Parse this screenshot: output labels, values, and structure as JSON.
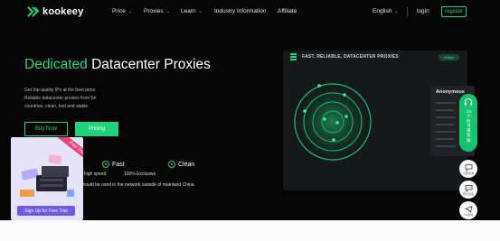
{
  "brand": {
    "name": "kookeey"
  },
  "nav": {
    "items": [
      {
        "label": "Price",
        "dropdown": true
      },
      {
        "label": "Proxies",
        "dropdown": true
      },
      {
        "label": "Learn",
        "dropdown": true
      },
      {
        "label": "Industry Information",
        "dropdown": false
      },
      {
        "label": "Affiliate",
        "dropdown": false
      }
    ],
    "language": "English",
    "login": "login",
    "register": "register"
  },
  "hero": {
    "title_accent": "Dedicated",
    "title_rest": "Datacenter Proxies",
    "description_lines": [
      "Get top-quality IPs at the best price.",
      "Reliable datacenter proxies from 54",
      "countries, clean, fast and stable"
    ],
    "buy_label": "Buy Now",
    "pricing_label": "Pricing"
  },
  "features": {
    "fast": "Fast",
    "clean": "Clean",
    "speed_text": "s high speed",
    "exclusive_text": "100% Exclusive",
    "notice": "should be used in the network outside of mainland China"
  },
  "dashboard": {
    "title": "FAST, RELIABLE, DATACENTER PROXIES",
    "badge": "Now",
    "anonymous_title": "Anonymous"
  },
  "float_bar": {
    "service_text": "24小时专属客服",
    "btn1": "立即咨询",
    "btn2": "意见反馈",
    "btn3": "TG咨询"
  },
  "promo": {
    "ribbon": "Free Trial",
    "button": "Sign Up for Free Trial"
  },
  "colors": {
    "accent": "#1ed47a",
    "promo_button": "#6f5ae0",
    "ribbon": "#e9447a"
  }
}
